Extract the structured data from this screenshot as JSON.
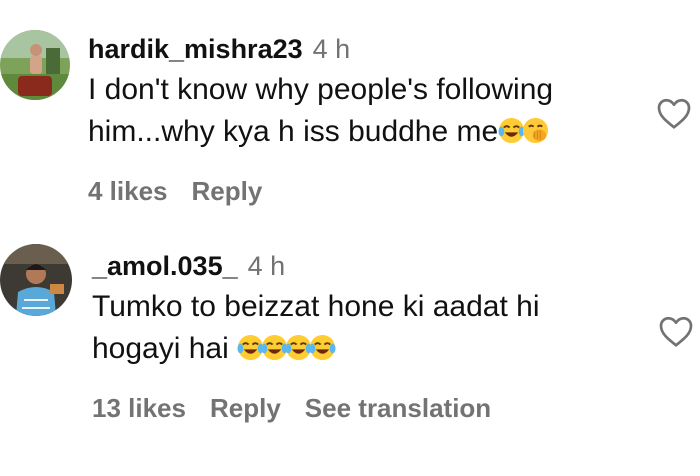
{
  "comments": [
    {
      "username": "hardik_mishra23",
      "time": "4 h",
      "text_line1": "I don't know why people's following",
      "text_line2": "him...why kya h iss buddhe me",
      "line2_emojis": [
        "face-with-tears-of-joy-emoji",
        "face-with-hand-over-mouth-emoji"
      ],
      "likes": "4 likes",
      "reply": "Reply"
    },
    {
      "username": "_amol.035_",
      "time": "4 h",
      "text_line1": "Tumko to beizzat hone ki aadat hi",
      "text_line2": "hogayi hai ",
      "line2_emojis": [
        "face-with-tears-of-joy-emoji",
        "face-with-tears-of-joy-emoji",
        "face-with-tears-of-joy-emoji",
        "face-with-tears-of-joy-emoji"
      ],
      "likes": "13 likes",
      "reply": "Reply",
      "translate": "See translation"
    }
  ],
  "icons": {
    "like": "heart-outline-icon"
  },
  "colors": {
    "primary_text": "#111111",
    "secondary_text": "#737373",
    "background": "#ffffff"
  }
}
